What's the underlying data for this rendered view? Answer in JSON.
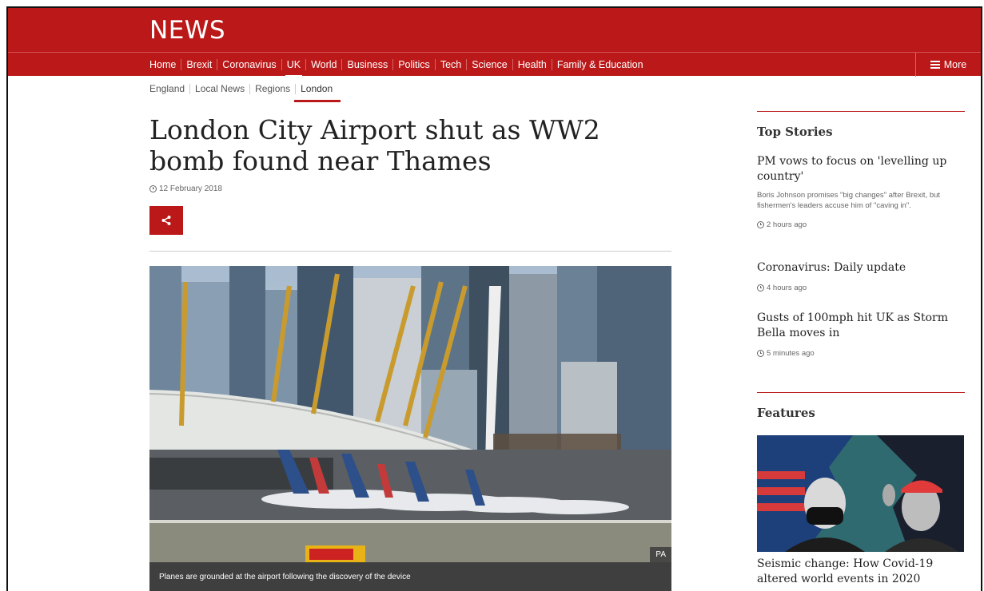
{
  "brand": {
    "logo": "NEWS",
    "accent_color": "#bb1919"
  },
  "nav": {
    "items": [
      {
        "label": "Home"
      },
      {
        "label": "Brexit"
      },
      {
        "label": "Coronavirus"
      },
      {
        "label": "UK",
        "active": true
      },
      {
        "label": "World"
      },
      {
        "label": "Business"
      },
      {
        "label": "Politics"
      },
      {
        "label": "Tech"
      },
      {
        "label": "Science"
      },
      {
        "label": "Health"
      },
      {
        "label": "Family & Education"
      }
    ],
    "more_label": "More"
  },
  "subnav": {
    "items": [
      {
        "label": "England"
      },
      {
        "label": "Local News"
      },
      {
        "label": "Regions"
      },
      {
        "label": "London",
        "active": true
      }
    ]
  },
  "article": {
    "headline": "London City Airport shut as WW2 bomb found near Thames",
    "date": "12 February 2018",
    "image_credit": "PA",
    "caption": "Planes are grounded at the airport following the discovery of the device",
    "share_icon": "share-icon"
  },
  "sidebar": {
    "top_stories_heading": "Top Stories",
    "stories": [
      {
        "title": "PM vows to focus on 'levelling up country'",
        "summary": "Boris Johnson promises \"big changes\" after Brexit, but fishermen's leaders accuse him of \"caving in\".",
        "time": "2 hours ago"
      },
      {
        "title": "Coronavirus: Daily update",
        "time": "4 hours ago"
      },
      {
        "title": "Gusts of 100mph hit UK as Storm Bella moves in",
        "time": "5 minutes ago"
      }
    ],
    "features_heading": "Features",
    "feature_title": "Seismic change: How Covid-19 altered world events in 2020"
  }
}
